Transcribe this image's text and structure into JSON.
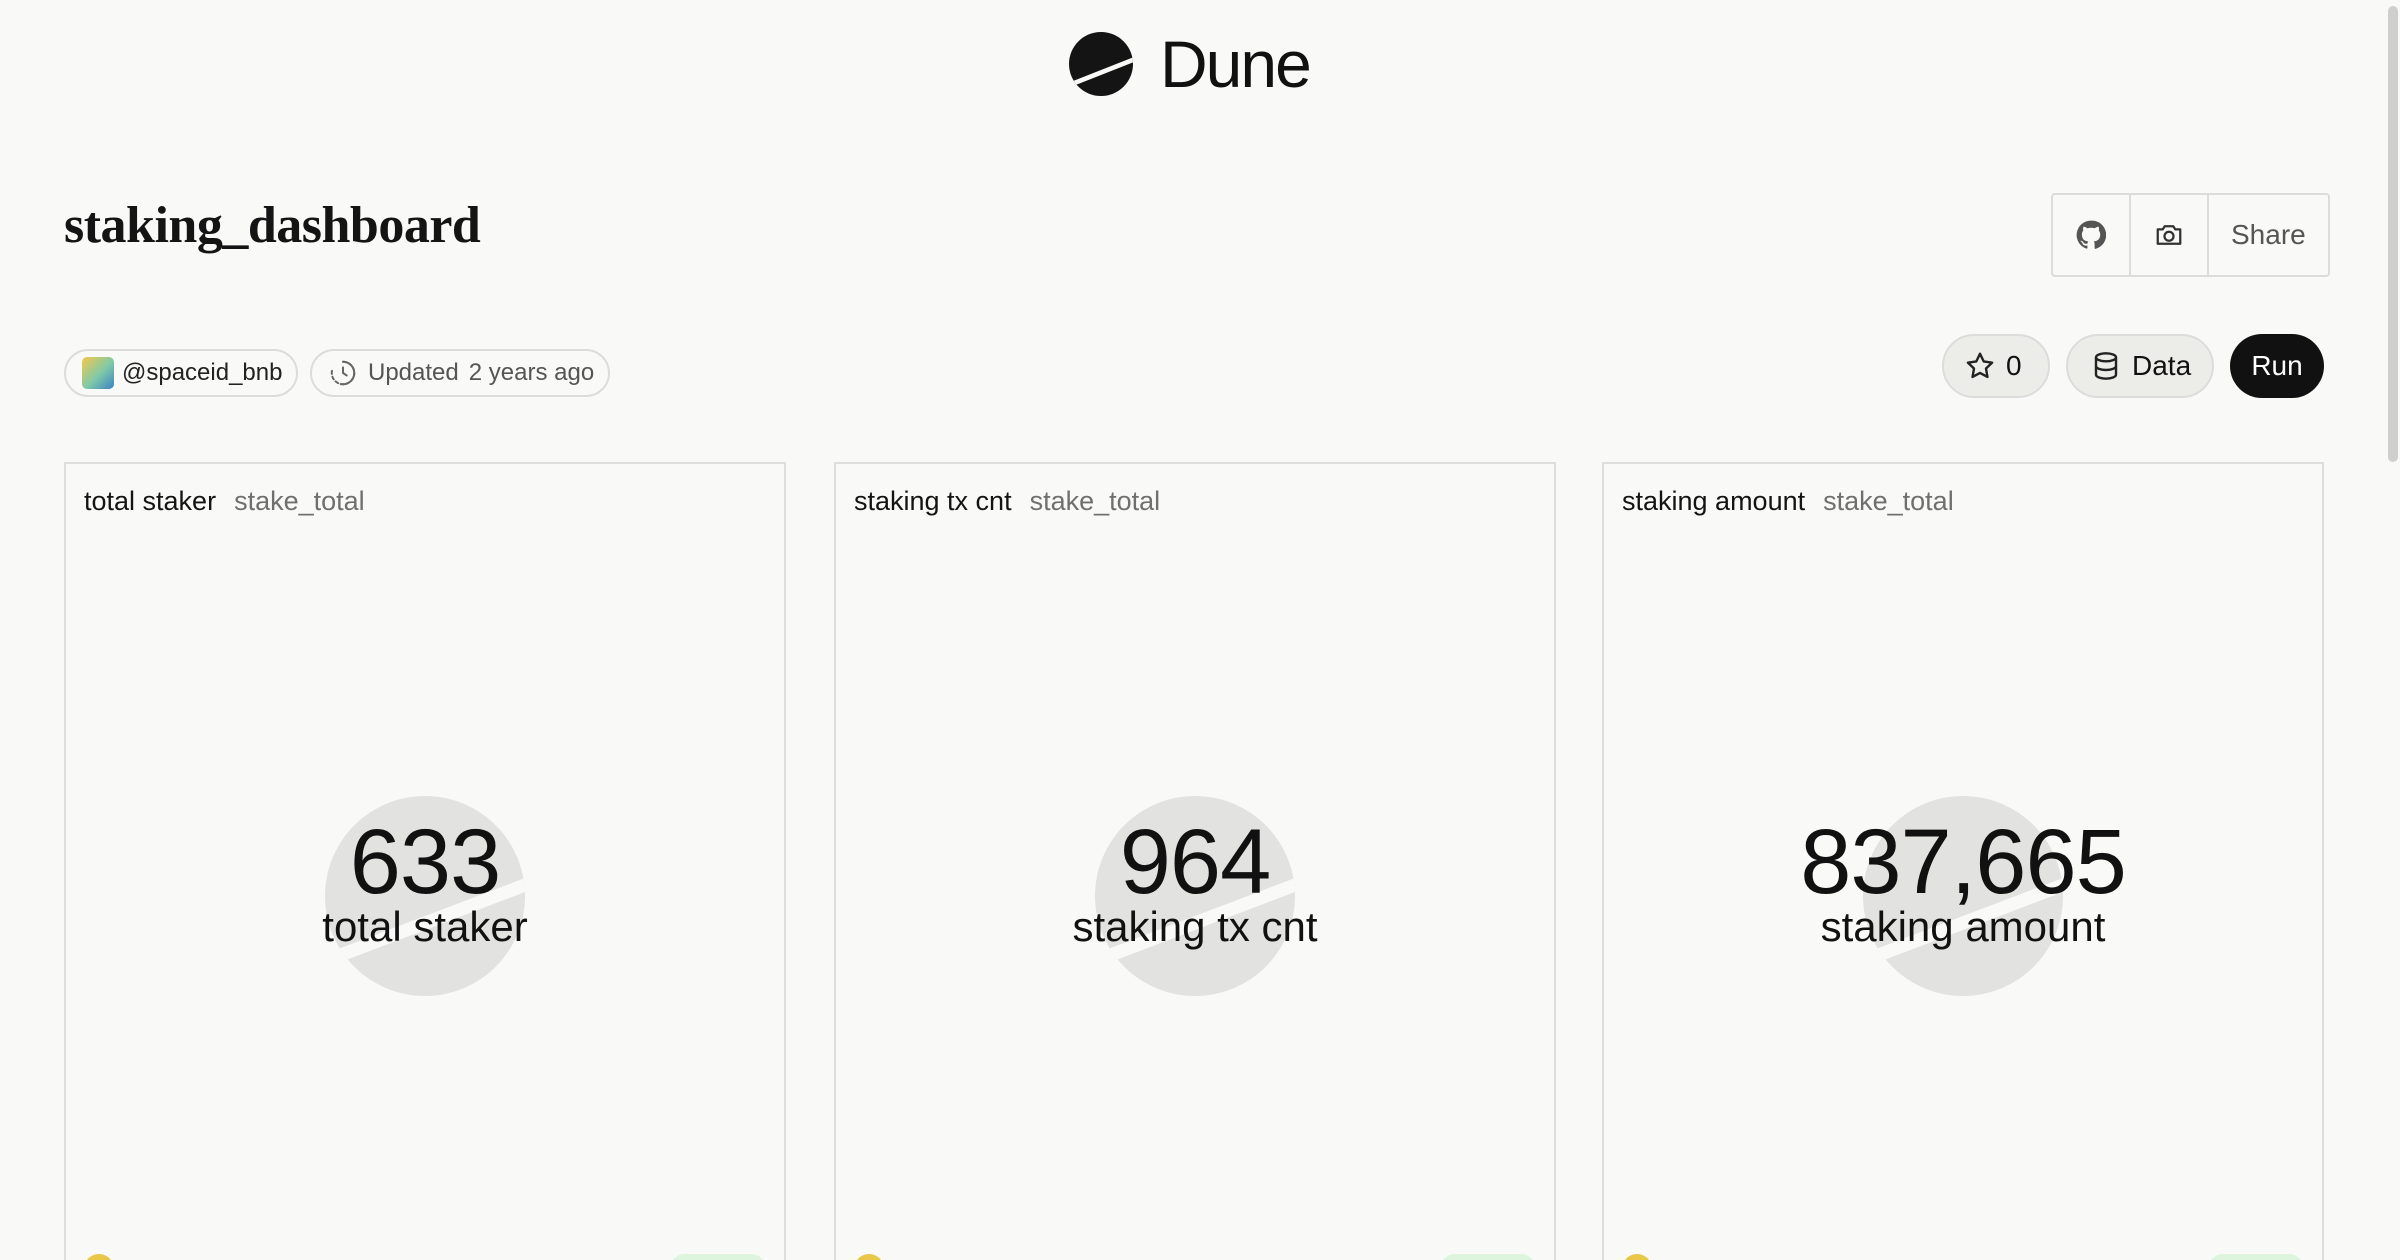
{
  "app": {
    "brand": "Dune"
  },
  "dashboard": {
    "title": "staking_dashboard"
  },
  "header_actions": {
    "share_label": "Share"
  },
  "meta": {
    "author": "@spaceid_bnb",
    "updated_label": "Updated",
    "updated_time": "2 years ago"
  },
  "actions": {
    "star_count": "0",
    "data_label": "Data",
    "run_label": "Run"
  },
  "widgets": [
    {
      "title": "total staker",
      "query": "stake_total",
      "value": "633",
      "label": "total staker"
    },
    {
      "title": "staking tx cnt",
      "query": "stake_total",
      "value": "964",
      "label": "staking tx cnt"
    },
    {
      "title": "staking amount",
      "query": "stake_total",
      "value": "837,665",
      "label": "staking amount"
    }
  ],
  "icons": {
    "logo": "dune-logo-icon",
    "github": "github-icon",
    "camera": "camera-icon",
    "clock": "clock-icon",
    "star": "star-icon",
    "database": "database-icon"
  },
  "colors": {
    "run_button": "#111111",
    "background": "#f9f9f8"
  }
}
